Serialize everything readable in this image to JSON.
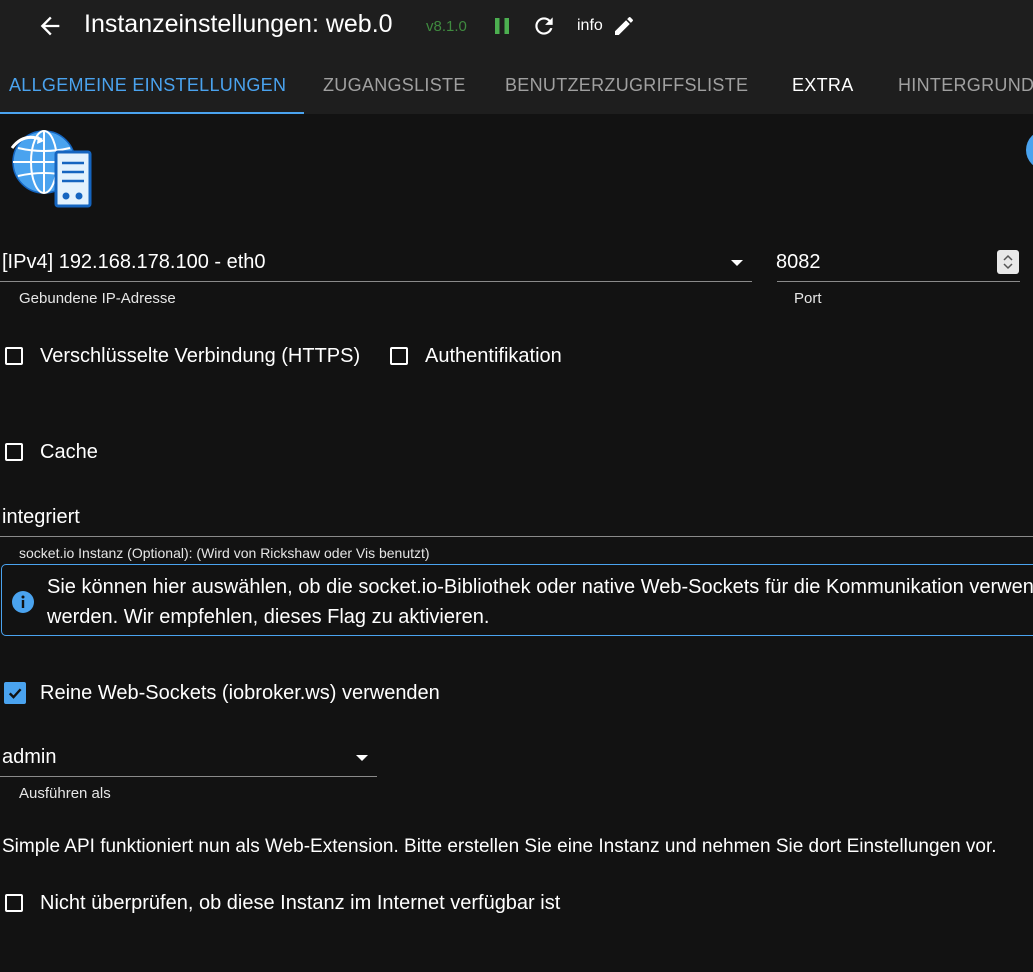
{
  "header": {
    "title": "Instanzeinstellungen: web.0",
    "version": "v8.1.0",
    "info_label": "info",
    "icons": {
      "back": "arrow-left-icon",
      "pause": "pause-icon",
      "reload": "reload-icon",
      "edit": "pencil-icon"
    },
    "colors": {
      "pause": "#4caf50",
      "version": "#3f8a3f"
    }
  },
  "tabs": [
    {
      "label": "ALLGEMEINE EINSTELLUNGEN",
      "active": true
    },
    {
      "label": "ZUGANGSLISTE",
      "active": false
    },
    {
      "label": "BENUTZERZUGRIFFSLISTE",
      "active": false
    },
    {
      "label": "EXTRA",
      "active": false
    },
    {
      "label": "HINTERGRUND",
      "active": false
    }
  ],
  "form": {
    "ip_select": {
      "value": "[IPv4] 192.168.178.100 - eth0",
      "label": "Gebundene IP-Adresse"
    },
    "port": {
      "value": "8082",
      "label": "Port"
    },
    "https": {
      "label": "Verschlüsselte Verbindung (HTTPS)",
      "checked": false
    },
    "auth": {
      "label": "Authentifikation",
      "checked": false
    },
    "cache": {
      "label": "Cache",
      "checked": false
    },
    "socketio": {
      "value": "integriert",
      "label": "socket.io Instanz (Optional): (Wird von Rickshaw oder Vis benutzt)"
    },
    "info_box": {
      "line1": "Sie können hier auswählen, ob die socket.io-Bibliothek oder native Web-Sockets für die Kommunikation verwendet",
      "line2": "werden. Wir empfehlen, dieses Flag zu aktivieren."
    },
    "pure_ws": {
      "label": "Reine Web-Sockets (iobroker.ws) verwenden",
      "checked": true
    },
    "run_as": {
      "value": "admin",
      "label": "Ausführen als"
    },
    "simple_api_note": "Simple API funktioniert nun als Web-Extension. Bitte erstellen Sie eine Instanz und nehmen Sie dort Einstellungen vor.",
    "no_check": {
      "label": "Nicht überprüfen, ob diese Instanz im Internet verfügbar ist",
      "checked": false
    }
  },
  "colors": {
    "accent": "#4aa3ef",
    "background": "#121212",
    "bar": "#1e1e1e"
  }
}
